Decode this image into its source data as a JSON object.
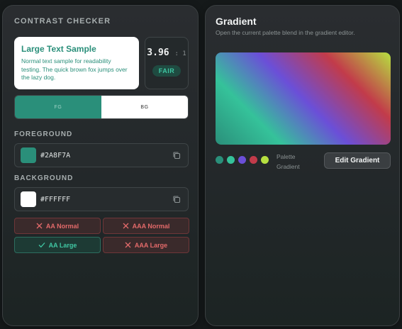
{
  "contrast": {
    "title": "CONTRAST CHECKER",
    "sample_title": "Large Text Sample",
    "sample_body": "Normal text sample for readability testing. The quick brown fox jumps over the lazy dog.",
    "ratio_value": "3.96",
    "ratio_suffix": ": 1",
    "ratio_badge": "FAIR",
    "toggle_fg": "FG",
    "toggle_bg": "BG",
    "foreground_label": "FOREGROUND",
    "foreground_hex": "#2A8F7A",
    "background_label": "BACKGROUND",
    "background_hex": "#FFFFFF",
    "badges": [
      {
        "label": "AA Normal",
        "status": "fail"
      },
      {
        "label": "AAA Normal",
        "status": "fail"
      },
      {
        "label": "AA Large",
        "status": "pass"
      },
      {
        "label": "AAA Large",
        "status": "fail"
      }
    ]
  },
  "gradient": {
    "title": "Gradient",
    "subtitle": "Open the current palette blend in the gradient editor.",
    "dot_colors": [
      "#2a8f7a",
      "#35c29a",
      "#6b4fd8",
      "#c23b4a",
      "#b6e040"
    ],
    "palette_label": "Palette",
    "gradient_label": "Gradient",
    "edit_button": "Edit Gradient"
  },
  "colors": {
    "accent": "#2a8f7a",
    "pass": "#40c7a3",
    "fail": "#e36a6a"
  },
  "icons": {
    "copy": "copy-icon",
    "fail": "x-icon",
    "pass": "check-icon"
  }
}
